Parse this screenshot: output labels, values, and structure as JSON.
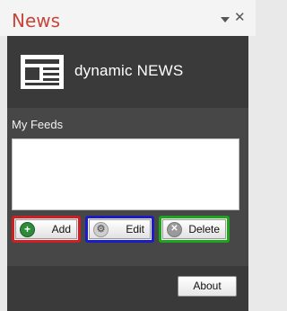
{
  "pane": {
    "title": "News",
    "menu_icon": "chevron-down-icon",
    "close_icon": "close-icon",
    "close_glyph": "✕"
  },
  "banner": {
    "logo_icon": "newspaper-icon",
    "title": "dynamic NEWS"
  },
  "feeds": {
    "label": "My Feeds",
    "items": []
  },
  "actions": {
    "add": {
      "label": "Add",
      "icon": "plus-circle-icon",
      "glyph": "+"
    },
    "edit": {
      "label": "Edit",
      "icon": "gear-icon",
      "glyph": "⚙"
    },
    "delete": {
      "label": "Delete",
      "icon": "x-circle-icon",
      "glyph": "✕"
    }
  },
  "footer": {
    "about_label": "About"
  },
  "colors": {
    "title": "#c8453a",
    "add_highlight": "#d11e22",
    "edit_highlight": "#1b1cc6",
    "delete_highlight": "#1ea51e",
    "panel_bg": "#474747"
  }
}
